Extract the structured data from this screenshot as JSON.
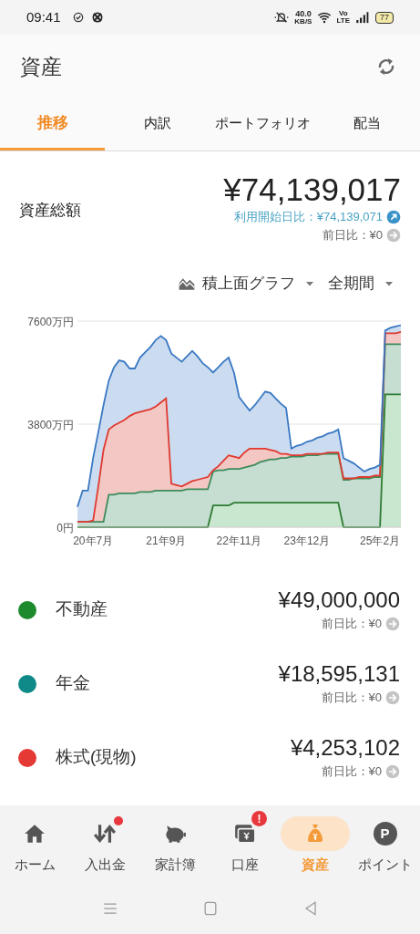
{
  "status_bar": {
    "time": "09:41",
    "net_speed": "40.0",
    "net_unit": "KB/S",
    "volte_top": "Vo",
    "volte_bottom": "LTE",
    "battery": "77"
  },
  "app_bar": {
    "title": "資産"
  },
  "tabs": [
    {
      "label": "推移",
      "selected": true
    },
    {
      "label": "内訳",
      "selected": false
    },
    {
      "label": "ポートフォリオ",
      "selected": false
    },
    {
      "label": "配当",
      "selected": false
    }
  ],
  "summary": {
    "label": "資産総額",
    "amount": "¥74,139,017",
    "changes": [
      {
        "kind": "since_start",
        "text": "利用開始日比：¥74,139,071"
      },
      {
        "kind": "daily",
        "text": "前日比：¥0"
      }
    ]
  },
  "chart_controls": [
    {
      "kind": "chart_type",
      "label": "積上面グラフ"
    },
    {
      "kind": "period",
      "label": "全期間"
    }
  ],
  "chart_data": {
    "type": "area",
    "stacked": true,
    "categories": [
      null,
      null,
      null,
      "20年7月",
      null,
      null,
      null,
      null,
      null,
      null,
      null,
      null,
      null,
      null,
      null,
      null,
      null,
      "21年9月",
      null,
      null,
      null,
      null,
      null,
      null,
      null,
      null,
      null,
      null,
      null,
      null,
      null,
      "22年11月",
      null,
      null,
      null,
      null,
      null,
      null,
      null,
      null,
      null,
      null,
      null,
      null,
      "23年12月",
      null,
      null,
      null,
      null,
      null,
      null,
      null,
      null,
      null,
      null,
      null,
      null,
      null,
      "25年2月",
      null,
      null,
      null,
      null
    ],
    "ylim": [
      0,
      7600
    ],
    "yticks": [
      {
        "value": 0,
        "label": "0円"
      },
      {
        "value": 3800,
        "label": "3800万円"
      },
      {
        "value": 7600,
        "label": "7600万円"
      }
    ],
    "series": [
      {
        "color": "#2e7d32",
        "values": [
          0,
          0,
          0,
          0,
          0,
          0,
          0,
          0,
          0,
          0,
          0,
          0,
          0,
          0,
          0,
          0,
          0,
          0,
          0,
          0,
          0,
          0,
          0,
          0,
          0,
          0,
          800,
          800,
          800,
          800,
          900,
          900,
          900,
          900,
          900,
          900,
          900,
          900,
          900,
          900,
          900,
          900,
          900,
          900,
          900,
          900,
          900,
          900,
          900,
          900,
          900,
          0,
          0,
          0,
          0,
          0,
          0,
          0,
          0,
          4900,
          4900,
          4900,
          4900
        ]
      },
      {
        "color": "#3d8b5a",
        "values": [
          200,
          200,
          200,
          200,
          200,
          200,
          1200,
          1200,
          1250,
          1250,
          1250,
          1250,
          1300,
          1300,
          1300,
          1350,
          1350,
          1350,
          1350,
          1350,
          1350,
          1400,
          1400,
          1400,
          1400,
          1400,
          1250,
          1300,
          1300,
          1350,
          1250,
          1250,
          1300,
          1350,
          1400,
          1500,
          1550,
          1600,
          1600,
          1650,
          1650,
          1700,
          1700,
          1700,
          1750,
          1750,
          1750,
          1800,
          1800,
          1800,
          1800,
          1750,
          1750,
          1800,
          1800,
          1800,
          1800,
          1850,
          1850,
          1850,
          1850,
          1850,
          1850
        ]
      },
      {
        "color": "#e0392f",
        "values": [
          0,
          0,
          0,
          50,
          1300,
          2650,
          2400,
          2550,
          2600,
          2700,
          2850,
          2950,
          2950,
          3000,
          3050,
          3100,
          3250,
          3400,
          250,
          200,
          150,
          200,
          300,
          350,
          400,
          450,
          50,
          150,
          350,
          500,
          450,
          400,
          550,
          650,
          600,
          500,
          450,
          350,
          300,
          150,
          150,
          50,
          50,
          50,
          50,
          50,
          50,
          0,
          50,
          50,
          50,
          50,
          50,
          0,
          50,
          50,
          50,
          50,
          50,
          400,
          400,
          400,
          450
        ]
      },
      {
        "color": "#3a78c2",
        "values": [
          550,
          1150,
          1150,
          2300,
          2000,
          1650,
          1800,
          2150,
          2300,
          2150,
          1750,
          1650,
          2000,
          2150,
          2300,
          2450,
          2450,
          2150,
          4800,
          4700,
          4600,
          4700,
          4800,
          4550,
          4250,
          4050,
          3600,
          3650,
          3650,
          3600,
          3100,
          2250,
          1800,
          1400,
          1600,
          1850,
          2100,
          2100,
          1950,
          1850,
          1700,
          250,
          350,
          400,
          450,
          500,
          600,
          650,
          700,
          750,
          850,
          750,
          650,
          550,
          350,
          200,
          300,
          300,
          400,
          100,
          200,
          250,
          250
        ]
      }
    ]
  },
  "assets": [
    {
      "name": "不動産",
      "color": "#1e8a2e",
      "amount": "¥49,000,000",
      "change": "前日比：¥0"
    },
    {
      "name": "年金",
      "color": "#0f8a88",
      "amount": "¥18,595,131",
      "change": "前日比：¥0"
    },
    {
      "name": "株式(現物)",
      "color": "#e53935",
      "amount": "¥4,253,102",
      "change": "前日比：¥0"
    }
  ],
  "bottom_nav": [
    {
      "kind": "home",
      "label": "ホーム",
      "selected": false
    },
    {
      "kind": "transfer",
      "label": "入出金",
      "selected": false,
      "badge": {
        "kind": "dot"
      }
    },
    {
      "kind": "household",
      "label": "家計簿",
      "selected": false
    },
    {
      "kind": "account",
      "label": "口座",
      "selected": false,
      "badge": {
        "kind": "alert",
        "text": "!"
      }
    },
    {
      "kind": "assets",
      "label": "資産",
      "selected": true
    },
    {
      "kind": "points",
      "label": "ポイント",
      "icon_text": "P",
      "selected": false
    }
  ],
  "system_nav": [
    {
      "kind": "menu"
    },
    {
      "kind": "home"
    },
    {
      "kind": "back"
    }
  ]
}
